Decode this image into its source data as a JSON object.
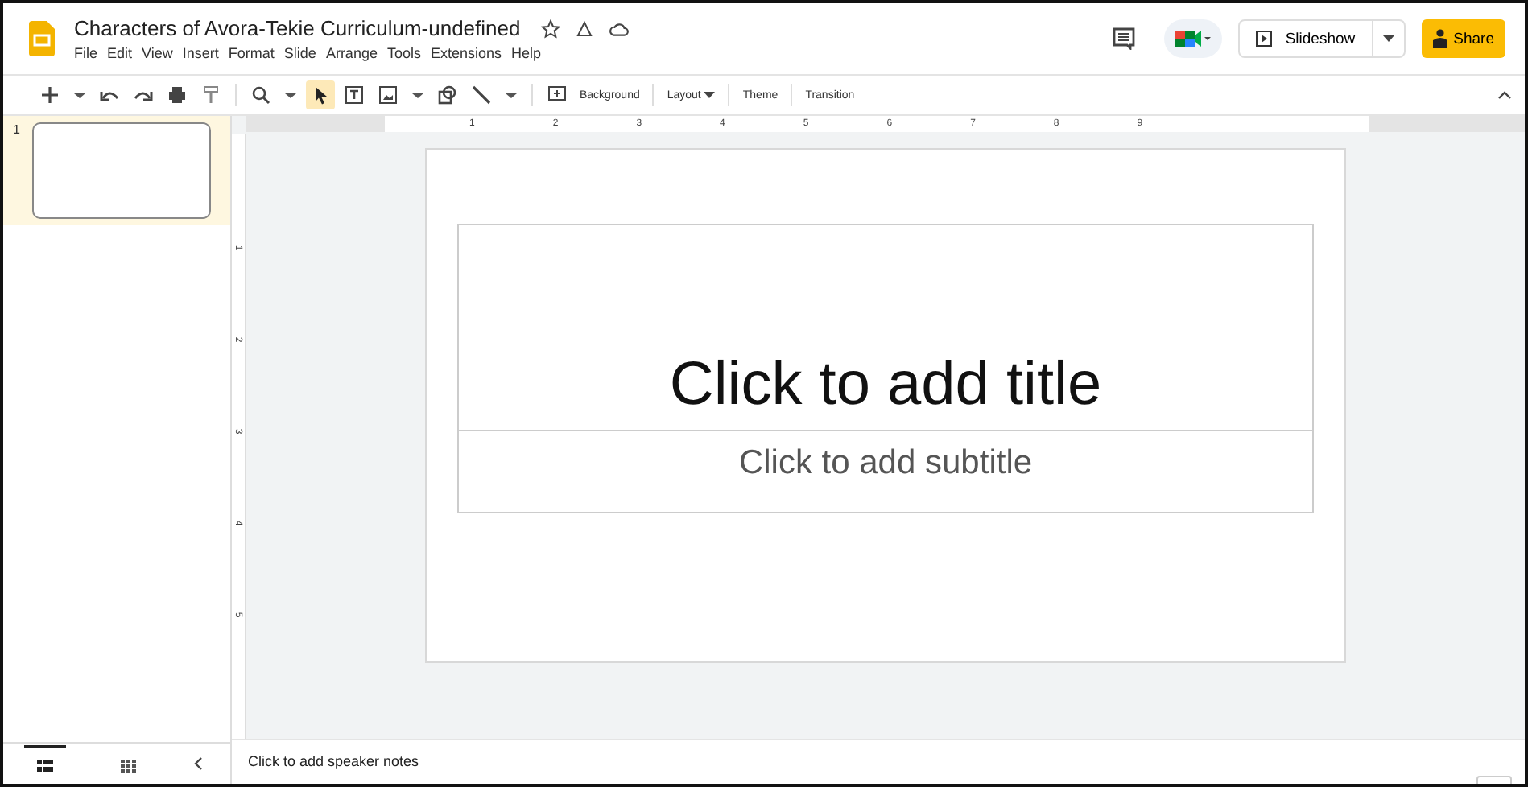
{
  "document": {
    "title": "Characters of Avora-Tekie Curriculum-undefined"
  },
  "menu": [
    "File",
    "Edit",
    "View",
    "Insert",
    "Format",
    "Slide",
    "Arrange",
    "Tools",
    "Extensions",
    "Help"
  ],
  "header_buttons": {
    "slideshow": "Slideshow",
    "share": "Share"
  },
  "tool_groups": [
    [
      {
        "kind": "plus",
        "selected": false
      },
      {
        "kind": "caret",
        "selected": false
      },
      {
        "kind": "undo",
        "selected": false
      },
      {
        "kind": "redo",
        "selected": false
      },
      {
        "kind": "print",
        "selected": false
      },
      {
        "kind": "paint",
        "selected": false
      }
    ],
    [
      {
        "kind": "zoom",
        "selected": false
      },
      {
        "kind": "caret",
        "selected": false
      },
      {
        "kind": "cursor",
        "selected": true
      },
      {
        "kind": "textbox",
        "selected": false
      },
      {
        "kind": "image",
        "selected": false
      },
      {
        "kind": "caret",
        "selected": false
      },
      {
        "kind": "shape",
        "selected": false
      },
      {
        "kind": "line",
        "selected": false
      },
      {
        "kind": "caret",
        "selected": false
      }
    ],
    [
      {
        "kind": "comment",
        "selected": false
      }
    ]
  ],
  "toolbar_buttons": [
    {
      "label": "Background",
      "dropdown": false
    },
    {
      "label": "Layout",
      "dropdown": true
    },
    {
      "label": "Theme",
      "dropdown": false
    },
    {
      "label": "Transition",
      "dropdown": false
    }
  ],
  "ruler": {
    "horizontal": [
      "1",
      "2",
      "3",
      "4",
      "5",
      "6",
      "7",
      "8",
      "9"
    ],
    "vertical": [
      "1",
      "2",
      "3",
      "4",
      "5"
    ]
  },
  "slides": [
    {
      "number": "1",
      "selected": true
    }
  ],
  "slide": {
    "title": "Click to add title",
    "subtitle": "Click to add subtitle"
  },
  "speaker_notes": {
    "text": "Click to add speaker notes"
  },
  "filmstrip_views": [
    {
      "kind": "list",
      "selected": true
    },
    {
      "kind": "grid",
      "selected": false
    }
  ]
}
